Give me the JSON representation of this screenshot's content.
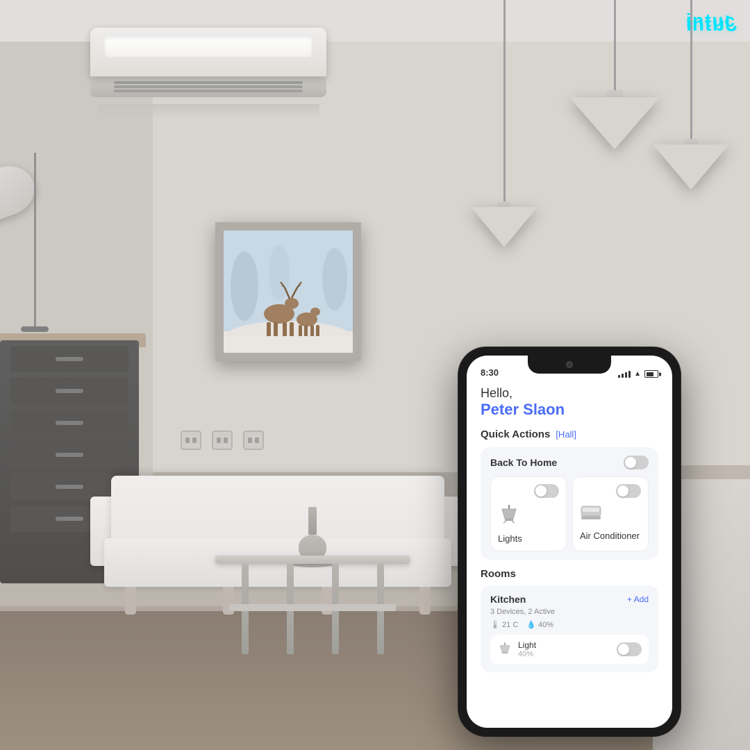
{
  "logo": {
    "text": "intuc",
    "brand_color": "#00e5ff"
  },
  "room": {
    "description": "Modern living room with AC, pendant lights, sofa, and coffee table"
  },
  "phone": {
    "status_bar": {
      "time": "8:30",
      "signal": "●●●",
      "wifi": "wifi",
      "battery": "70"
    },
    "app": {
      "greeting_prefix": "Hello,",
      "user_name": "Peter Slaon",
      "quick_actions_label": "Quick Actions",
      "room_tag": "[Hall]",
      "back_to_home": {
        "title": "Back To Home",
        "toggle_state": "off"
      },
      "devices": [
        {
          "name": "Lights",
          "icon": "💡",
          "toggle_state": "off"
        },
        {
          "name": "Air Conditioner",
          "icon": "❄️",
          "toggle_state": "off"
        }
      ],
      "rooms_label": "Rooms",
      "rooms": [
        {
          "name": "Kitchen",
          "add_label": "+ Add",
          "info": "3 Devices, 2 Active",
          "temp": "21 C",
          "humidity": "40%",
          "devices": [
            {
              "name": "Light",
              "icon": "💡",
              "percent": "40%",
              "toggle_state": "off"
            }
          ]
        }
      ]
    }
  }
}
